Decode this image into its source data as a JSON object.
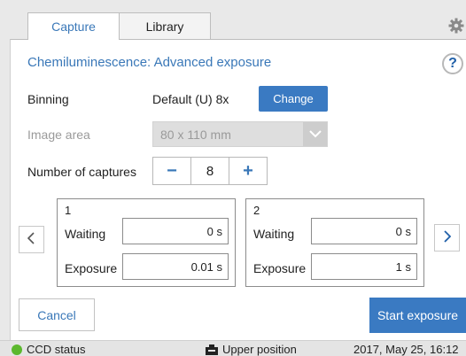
{
  "tabs": [
    {
      "label": "Capture",
      "active": true
    },
    {
      "label": "Library",
      "active": false
    }
  ],
  "icons": {
    "settings": "gear-icon",
    "help": "help-icon",
    "select_arrow": "chevron-down-icon",
    "prev": "chevron-left-icon",
    "next": "chevron-right-icon",
    "position": "camera-icon"
  },
  "title": "Chemiluminescence: Advanced exposure",
  "help_glyph": "?",
  "binning": {
    "label": "Binning",
    "value": "Default (U) 8x",
    "change_label": "Change"
  },
  "image_area": {
    "label": "Image area",
    "value": "80 x 110 mm",
    "enabled": false
  },
  "captures": {
    "label": "Number of captures",
    "decrement": "−",
    "increment": "+",
    "value": "8",
    "items": [
      {
        "index": "1",
        "waiting_label": "Waiting",
        "waiting": "0 s",
        "exposure_label": "Exposure",
        "exposure": "0.01 s"
      },
      {
        "index": "2",
        "waiting_label": "Waiting",
        "waiting": "0 s",
        "exposure_label": "Exposure",
        "exposure": "1 s"
      }
    ]
  },
  "actions": {
    "cancel": "Cancel",
    "start": "Start exposure"
  },
  "status": {
    "ccd_label": "CCD status",
    "ccd_color": "#5cb82e",
    "position": "Upper position",
    "datetime": "2017, May 25, 16:12"
  },
  "colors": {
    "accent": "#3a78b8",
    "button": "#3a7ac2"
  }
}
